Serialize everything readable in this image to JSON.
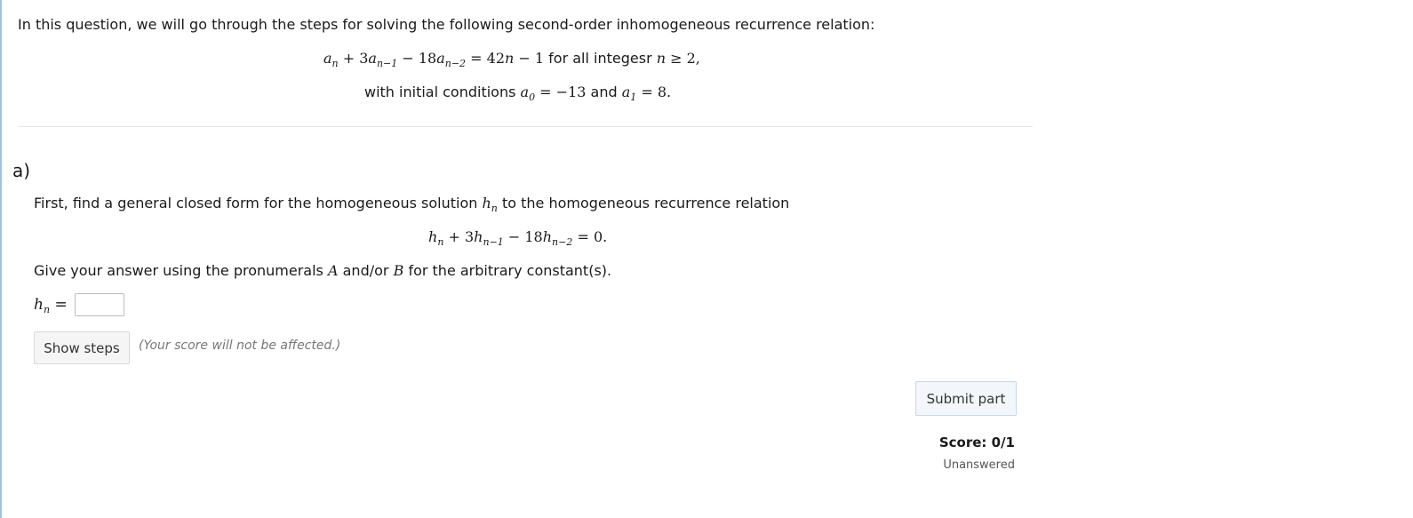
{
  "intro": {
    "text": "In this question, we will go through the steps for solving the following second-order inhomogeneous recurrence relation:",
    "relation_rhs_text": "for all integesr",
    "initial_text": "with initial conditions",
    "and_text": "and"
  },
  "part_a": {
    "label": "a)",
    "prompt_before": "First, find a general closed form for the homogeneous solution",
    "prompt_after": "to the homogeneous recurrence relation",
    "give_answer_before": "Give your answer using the pronumerals",
    "give_answer_mid": "and/or",
    "give_answer_after": "for the arbitrary constant(s).",
    "const_a": "A",
    "const_b": "B",
    "answer_value": ""
  },
  "buttons": {
    "show_steps": "Show steps",
    "steps_note": "(Your score will not be affected.)",
    "submit": "Submit part"
  },
  "score": {
    "label": "Score: 0/1",
    "status": "Unanswered"
  }
}
